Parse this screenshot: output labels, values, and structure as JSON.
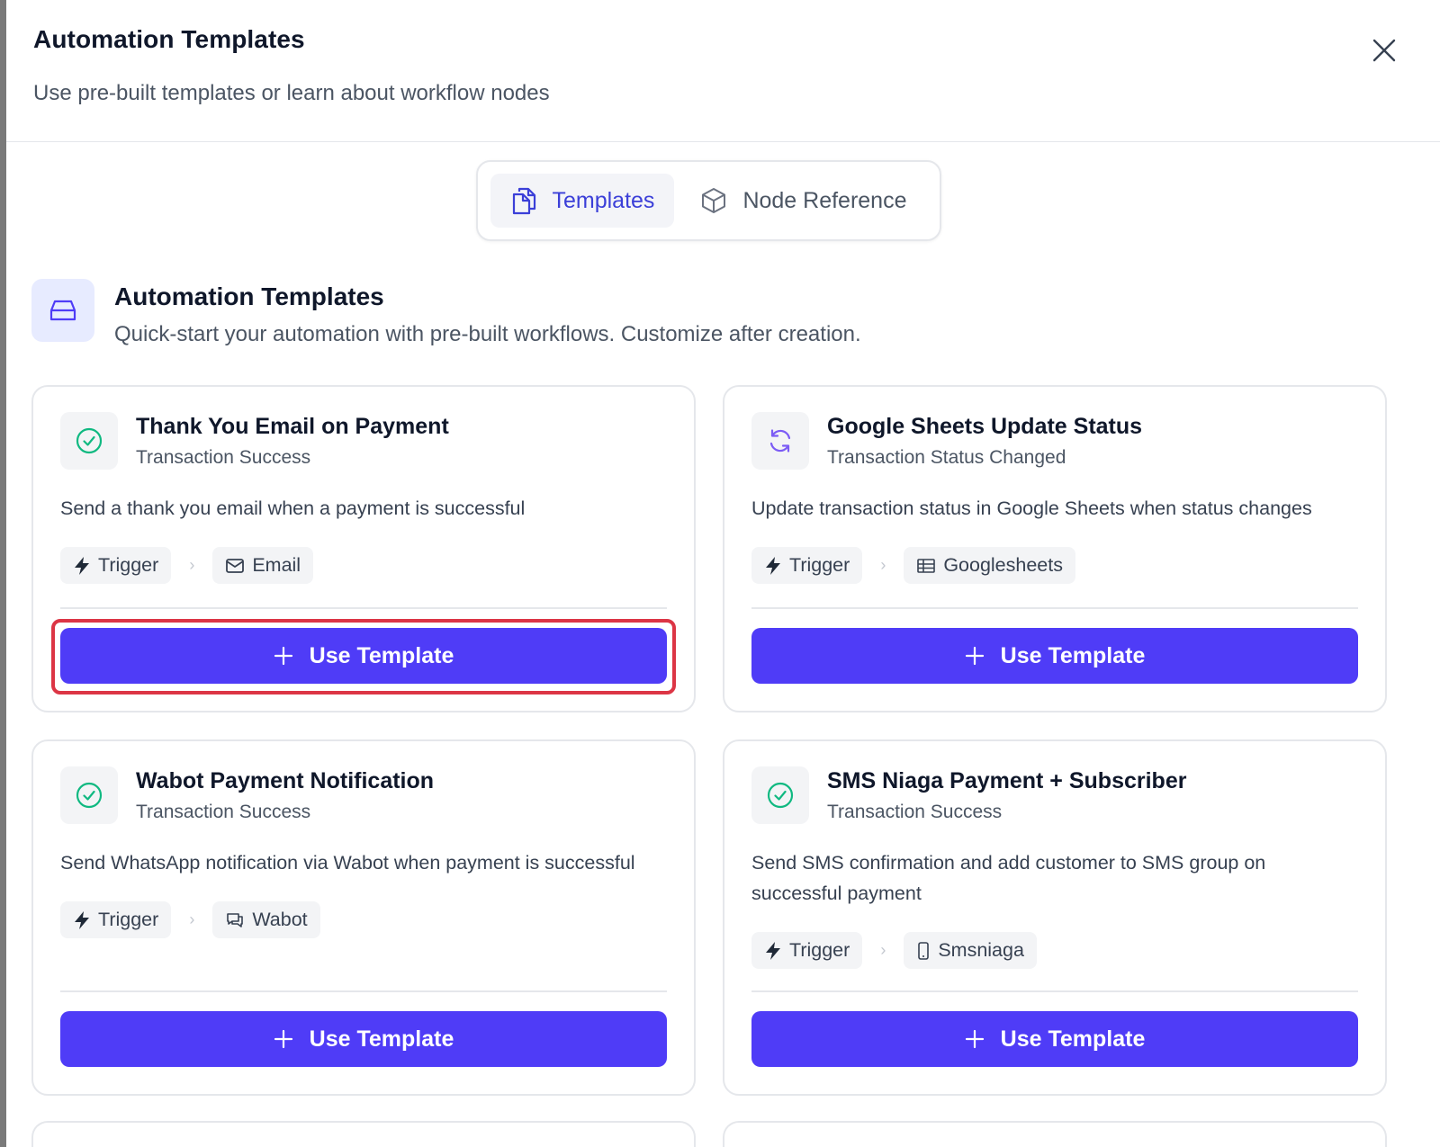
{
  "modal": {
    "title": "Automation Templates",
    "subtitle": "Use pre-built templates or learn about workflow nodes",
    "close_icon": "close-icon"
  },
  "tabs": [
    {
      "label": "Templates",
      "icon": "copy-icon",
      "active": true
    },
    {
      "label": "Node Reference",
      "icon": "cube-icon",
      "active": false
    }
  ],
  "section": {
    "title": "Automation Templates",
    "description": "Quick-start your automation with pre-built workflows. Customize after creation.",
    "icon": "inbox-icon"
  },
  "colors": {
    "accent": "#4f3cf7",
    "active_tab": "#3b3fd8",
    "success": "#10b981",
    "sync": "#7c5cf5",
    "highlight": "#dc3545"
  },
  "templates": [
    {
      "title": "Thank You Email on Payment",
      "trigger_event": "Transaction Success",
      "description": "Send a thank you email when a payment is successful",
      "icon": "check-circle-icon",
      "chips": [
        {
          "label": "Trigger",
          "icon": "bolt-icon"
        },
        {
          "label": "Email",
          "icon": "mail-icon"
        }
      ],
      "button_label": "Use Template",
      "highlighted": true
    },
    {
      "title": "Google Sheets Update Status",
      "trigger_event": "Transaction Status Changed",
      "description": "Update transaction status in Google Sheets when status changes",
      "icon": "refresh-icon",
      "chips": [
        {
          "label": "Trigger",
          "icon": "bolt-icon"
        },
        {
          "label": "Googlesheets",
          "icon": "sheet-icon"
        }
      ],
      "button_label": "Use Template",
      "highlighted": false
    },
    {
      "title": "Wabot Payment Notification",
      "trigger_event": "Transaction Success",
      "description": "Send WhatsApp notification via Wabot when payment is successful",
      "icon": "check-circle-icon",
      "chips": [
        {
          "label": "Trigger",
          "icon": "bolt-icon"
        },
        {
          "label": "Wabot",
          "icon": "chat-icon"
        }
      ],
      "button_label": "Use Template",
      "highlighted": false
    },
    {
      "title": "SMS Niaga Payment + Subscriber",
      "trigger_event": "Transaction Success",
      "description": "Send SMS confirmation and add customer to SMS group on successful payment",
      "icon": "check-circle-icon",
      "chips": [
        {
          "label": "Trigger",
          "icon": "bolt-icon"
        },
        {
          "label": "Smsniaga",
          "icon": "phone-icon"
        }
      ],
      "button_label": "Use Template",
      "highlighted": false
    }
  ]
}
